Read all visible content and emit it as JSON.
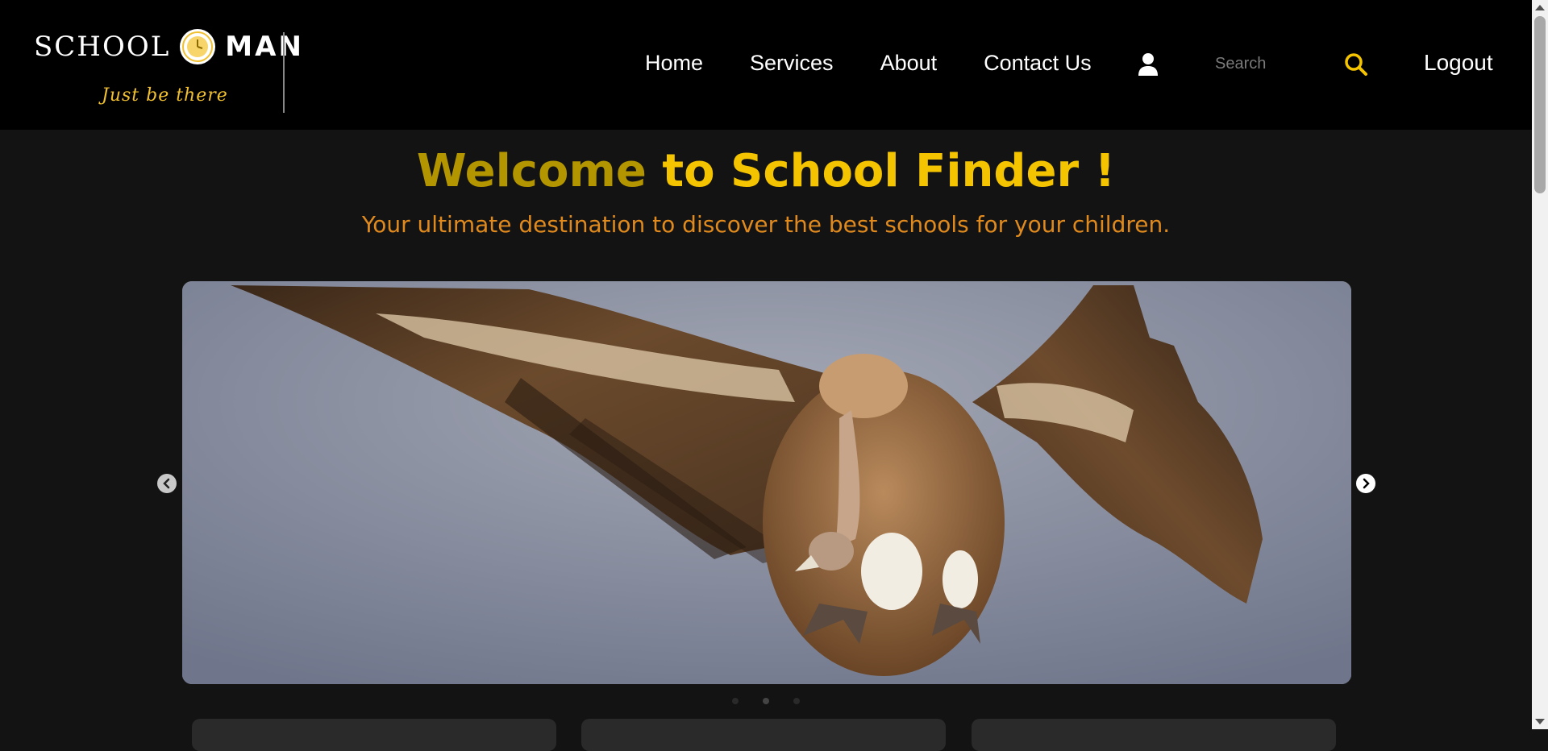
{
  "header": {
    "logo_school": "SCHOOL",
    "logo_man": "MAN",
    "logo_tagline": "Just be there",
    "nav": [
      "Home",
      "Services",
      "About",
      "Contact Us"
    ],
    "search_placeholder": "Search",
    "logout_label": "Logout"
  },
  "hero": {
    "welcome_part1": "Welcome",
    "welcome_part2": "to School Finder !",
    "subtitle": "Your ultimate destination to discover the best schools for your children."
  },
  "carousel": {
    "active_slide": 2,
    "slide_count": 3
  },
  "colors": {
    "accent_gold": "#f5c400",
    "accent_dark_gold": "#b39500",
    "subtitle_orange": "#e08a1e",
    "background": "#131313"
  }
}
